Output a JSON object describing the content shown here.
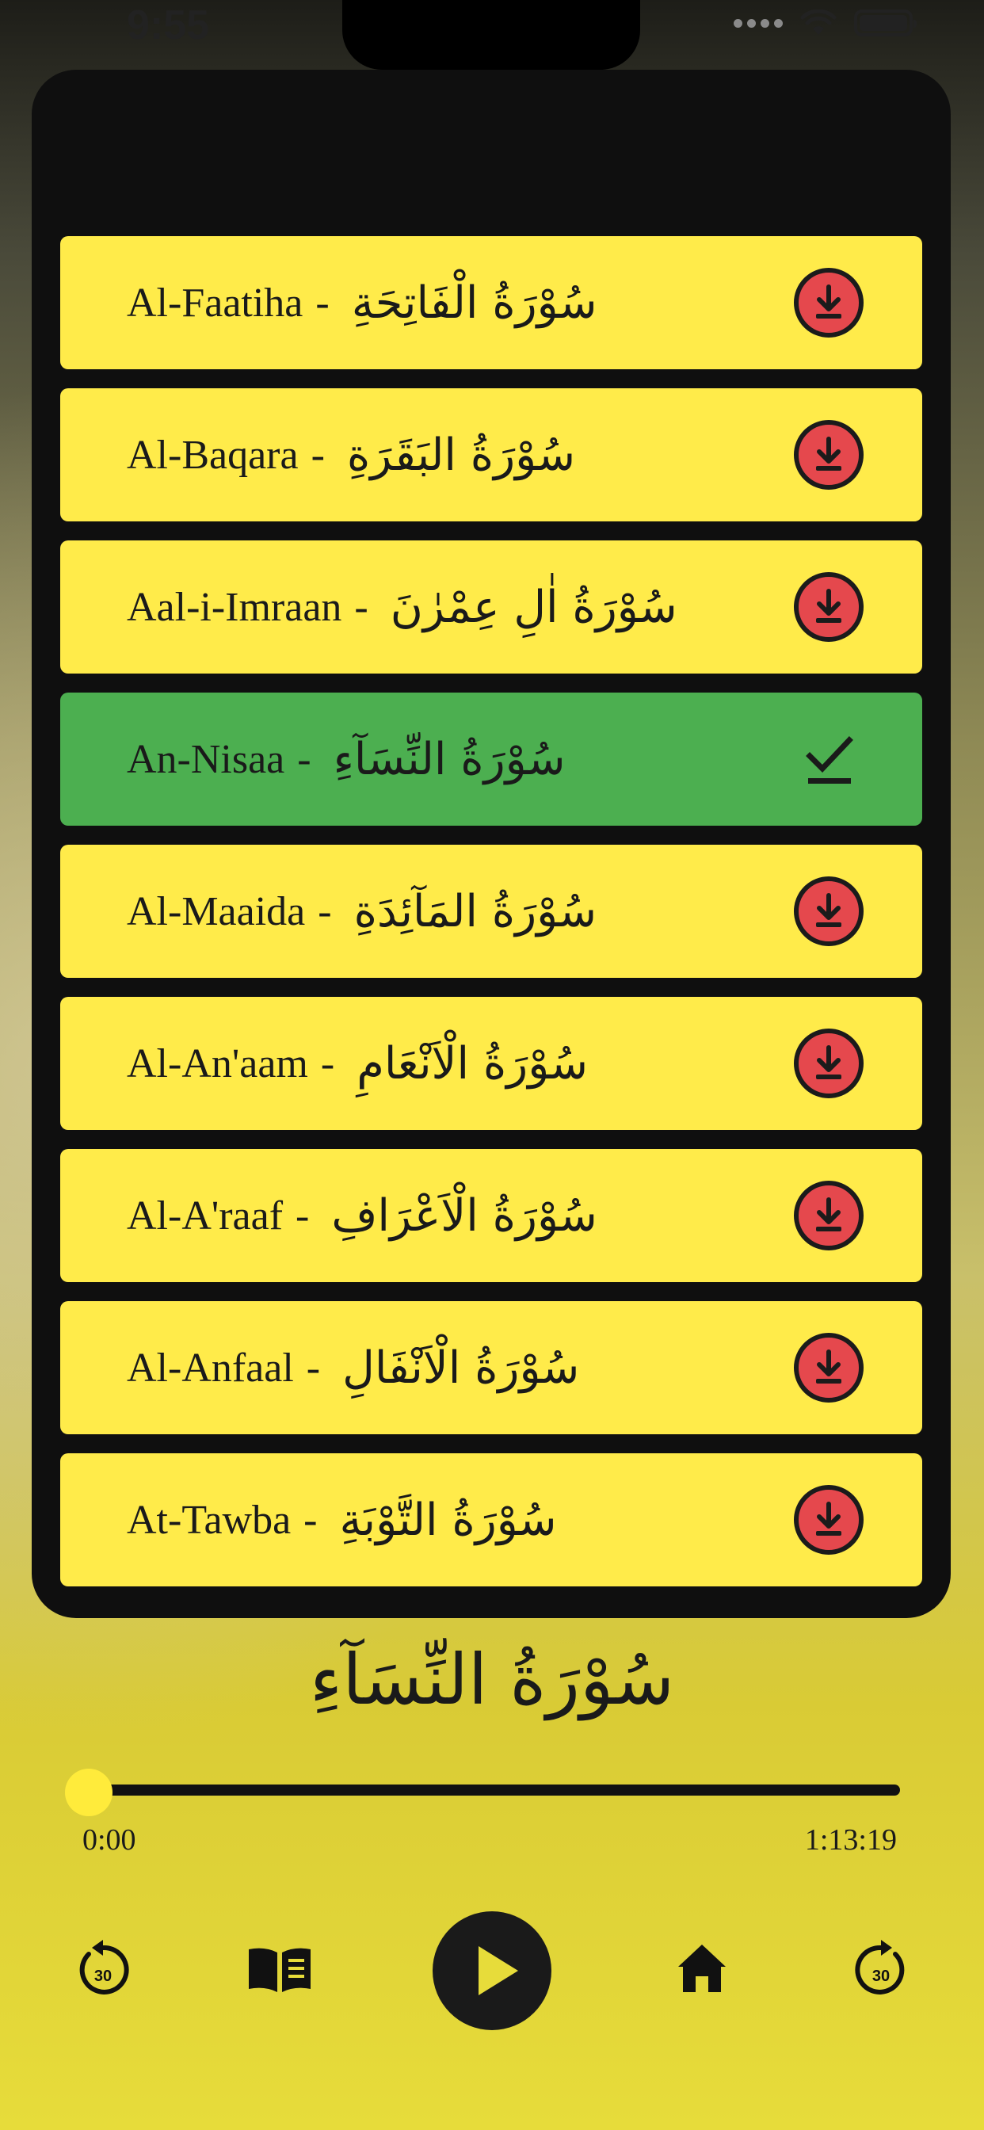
{
  "status_bar": {
    "time": "9:55"
  },
  "surah_list": [
    {
      "english": "Al-Faatiha",
      "arabic": "سُوْرَةُ الْفَاتِحَةِ",
      "state": "download"
    },
    {
      "english": "Al-Baqara",
      "arabic": "سُوْرَةُ البَقَرَةِ",
      "state": "download"
    },
    {
      "english": "Aal-i-Imraan",
      "arabic": "سُوْرَةُ اٰلِ عِمْرٰنَ",
      "state": "download"
    },
    {
      "english": "An-Nisaa",
      "arabic": "سُوْرَةُ النِّسَآءِ",
      "state": "downloaded"
    },
    {
      "english": "Al-Maaida",
      "arabic": "سُوْرَةُ المَآئِدَةِ",
      "state": "download"
    },
    {
      "english": "Al-An'aam",
      "arabic": "سُوْرَةُ الْاَنْعَامِ",
      "state": "download"
    },
    {
      "english": "Al-A'raaf",
      "arabic": "سُوْرَةُ الْاَعْرَافِ",
      "state": "download"
    },
    {
      "english": "Al-Anfaal",
      "arabic": "سُوْرَةُ الْاَنْفَالِ",
      "state": "download"
    },
    {
      "english": "At-Tawba",
      "arabic": "سُوْرَةُ التَّوْبَةِ",
      "state": "download"
    }
  ],
  "separator": "-",
  "player": {
    "now_playing": "سُوْرَةُ النِّسَآءِ",
    "current_time": "0:00",
    "total_time": "1:13:19",
    "progress": 0,
    "skip_back_seconds": "30",
    "skip_forward_seconds": "30"
  },
  "colors": {
    "row_default": "#ffeb4a",
    "row_downloaded": "#4caf50",
    "download_button": "#e5484d",
    "panel": "#0f0f0f"
  },
  "icons": {
    "download": "download-circle-icon",
    "downloaded": "checkmark-icon",
    "skip_back": "rotate-left-30-icon",
    "read": "book-open-icon",
    "play": "play-icon",
    "home": "home-icon",
    "skip_forward": "rotate-right-30-icon"
  }
}
